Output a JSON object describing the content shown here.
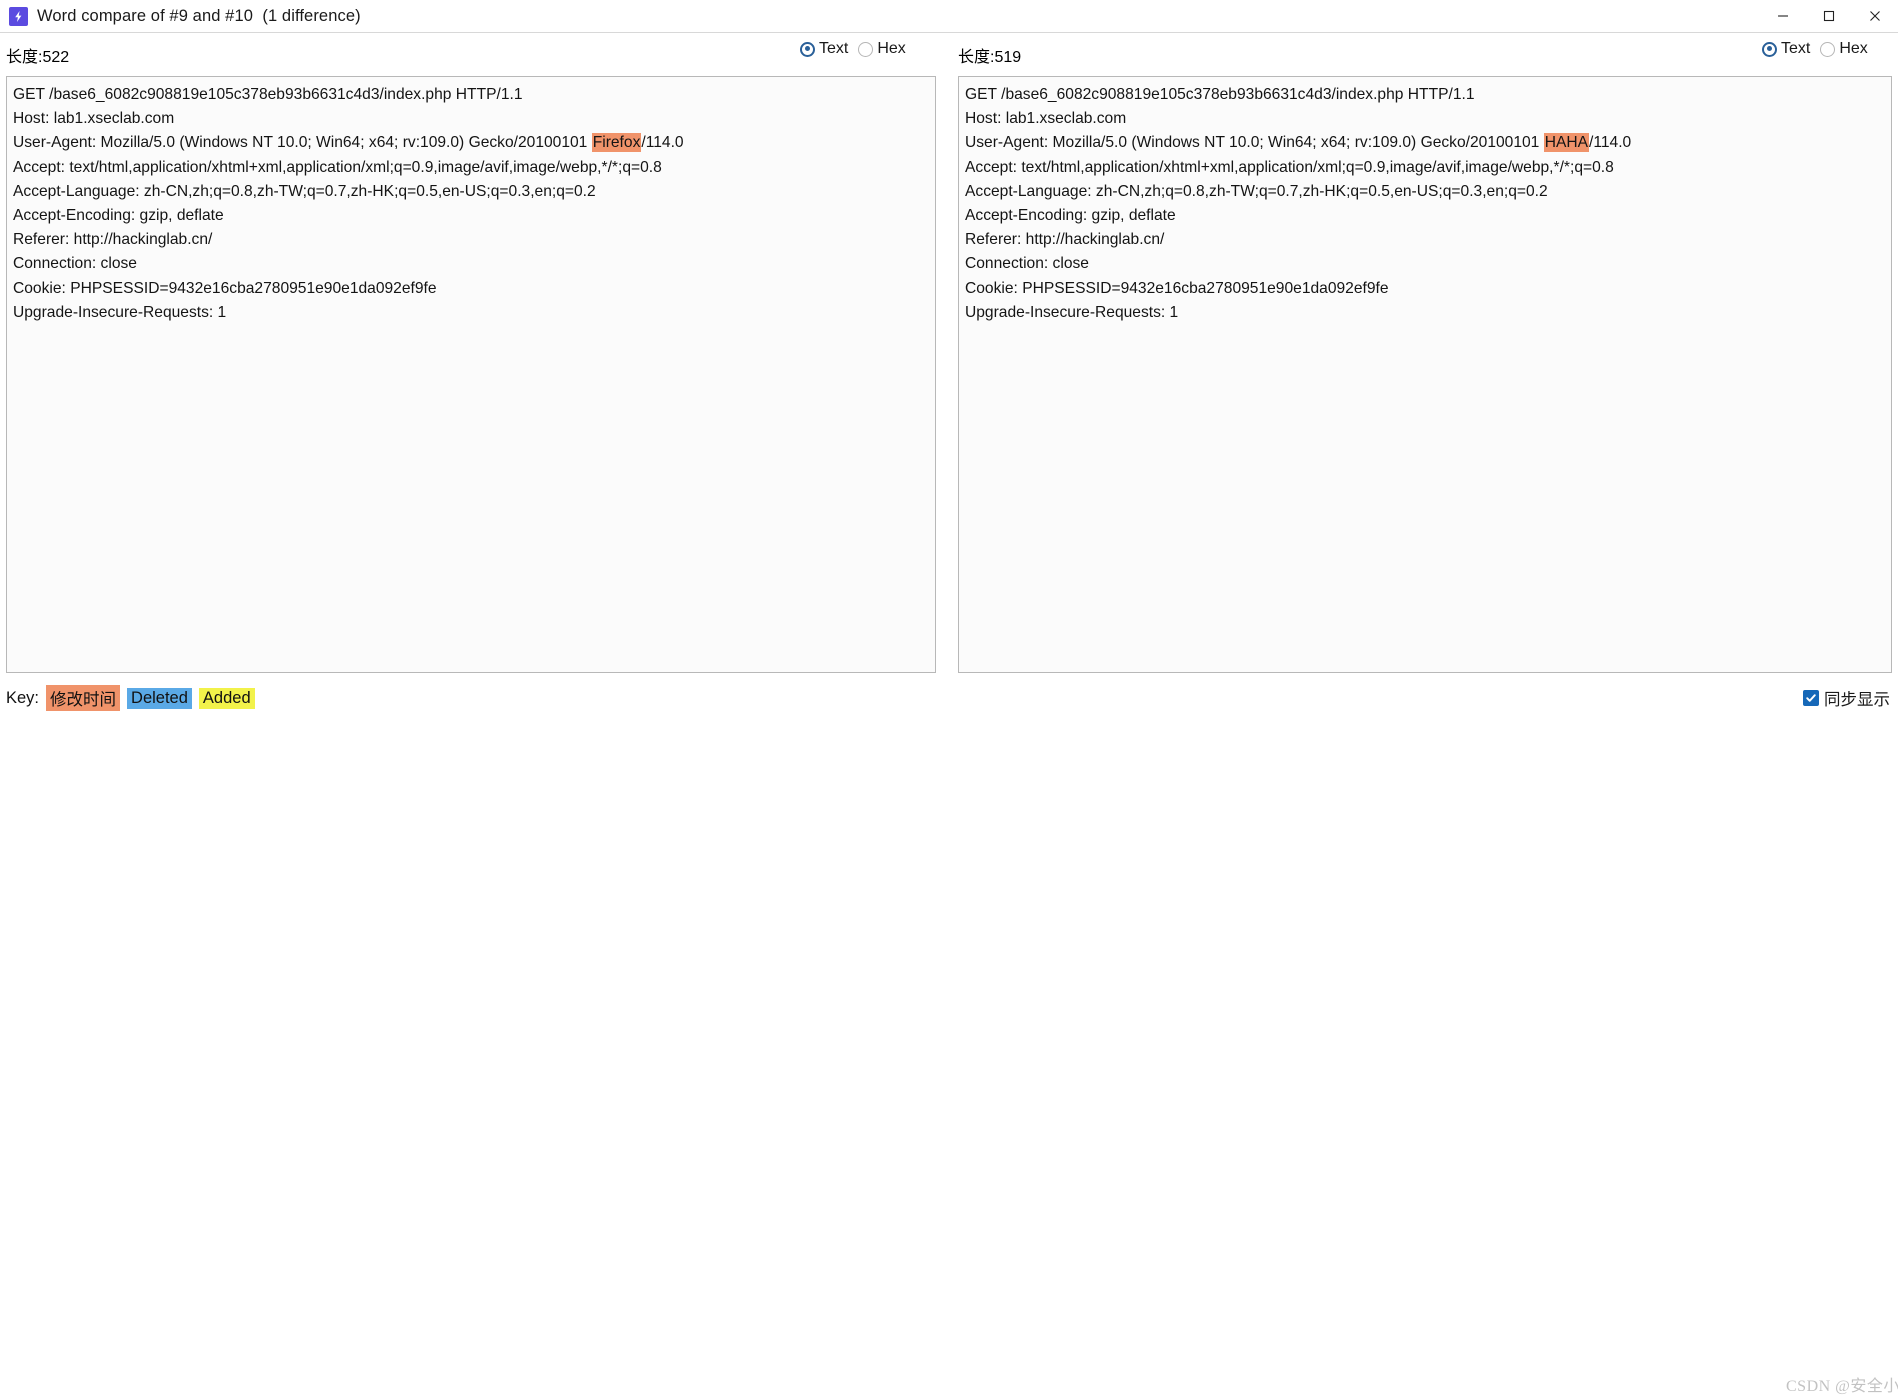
{
  "window": {
    "title": "Word compare of #9 and #10  (1 difference)",
    "icon": "burp-lightning-icon",
    "minimize_label": "–",
    "maximize_label": "□",
    "close_label": "×"
  },
  "colors": {
    "changed_highlight": "#f0936a",
    "deleted_highlight": "#5aa9e6",
    "added_highlight": "#f2f24a",
    "radio_accent": "#2a6099",
    "checkbox_accent": "#1668b8",
    "app_icon": "#5b4be0"
  },
  "left": {
    "length_label": "长度:522",
    "view_modes": [
      {
        "label": "Text",
        "selected": true
      },
      {
        "label": "Hex",
        "selected": false
      }
    ],
    "lines": [
      [
        {
          "t": "GET /base6_6082c908819e105c378eb93b6631c4d3/index.php HTTP/1.1"
        }
      ],
      [
        {
          "t": "Host: lab1.xseclab.com"
        }
      ],
      [
        {
          "t": "User-Agent: Mozilla/5.0 (Windows NT 10.0; Win64; x64; rv:109.0) Gecko/20100101 "
        },
        {
          "t": "Firefox",
          "hl": "changed"
        },
        {
          "t": "/114.0"
        }
      ],
      [
        {
          "t": "Accept: text/html,application/xhtml+xml,application/xml;q=0.9,image/avif,image/webp,*/*;q=0.8"
        }
      ],
      [
        {
          "t": "Accept-Language: zh-CN,zh;q=0.8,zh-TW;q=0.7,zh-HK;q=0.5,en-US;q=0.3,en;q=0.2"
        }
      ],
      [
        {
          "t": "Accept-Encoding: gzip, deflate"
        }
      ],
      [
        {
          "t": "Referer: http://hackinglab.cn/"
        }
      ],
      [
        {
          "t": "Connection: close"
        }
      ],
      [
        {
          "t": "Cookie: PHPSESSID=9432e16cba2780951e90e1da092ef9fe"
        }
      ],
      [
        {
          "t": "Upgrade-Insecure-Requests: 1"
        }
      ]
    ]
  },
  "right": {
    "length_label": "长度:519",
    "view_modes": [
      {
        "label": "Text",
        "selected": true
      },
      {
        "label": "Hex",
        "selected": false
      }
    ],
    "lines": [
      [
        {
          "t": "GET /base6_6082c908819e105c378eb93b6631c4d3/index.php HTTP/1.1"
        }
      ],
      [
        {
          "t": "Host: lab1.xseclab.com"
        }
      ],
      [
        {
          "t": "User-Agent: Mozilla/5.0 (Windows NT 10.0; Win64; x64; rv:109.0) Gecko/20100101 "
        },
        {
          "t": "HAHA",
          "hl": "changed"
        },
        {
          "t": "/114.0"
        }
      ],
      [
        {
          "t": "Accept: text/html,application/xhtml+xml,application/xml;q=0.9,image/avif,image/webp,*/*;q=0.8"
        }
      ],
      [
        {
          "t": "Accept-Language: zh-CN,zh;q=0.8,zh-TW;q=0.7,zh-HK;q=0.5,en-US;q=0.3,en;q=0.2"
        }
      ],
      [
        {
          "t": "Accept-Encoding: gzip, deflate"
        }
      ],
      [
        {
          "t": "Referer: http://hackinglab.cn/"
        }
      ],
      [
        {
          "t": "Connection: close"
        }
      ],
      [
        {
          "t": "Cookie: PHPSESSID=9432e16cba2780951e90e1da092ef9fe"
        }
      ],
      [
        {
          "t": "Upgrade-Insecure-Requests: 1"
        }
      ]
    ]
  },
  "footer": {
    "key_label": "Key:",
    "key_items": [
      {
        "label": "修改时间",
        "kind": "changed"
      },
      {
        "label": "Deleted",
        "kind": "deleted"
      },
      {
        "label": "Added",
        "kind": "added"
      }
    ],
    "sync_checkbox": {
      "label": "同步显示",
      "checked": true
    }
  },
  "watermark": "CSDN @安全小白"
}
